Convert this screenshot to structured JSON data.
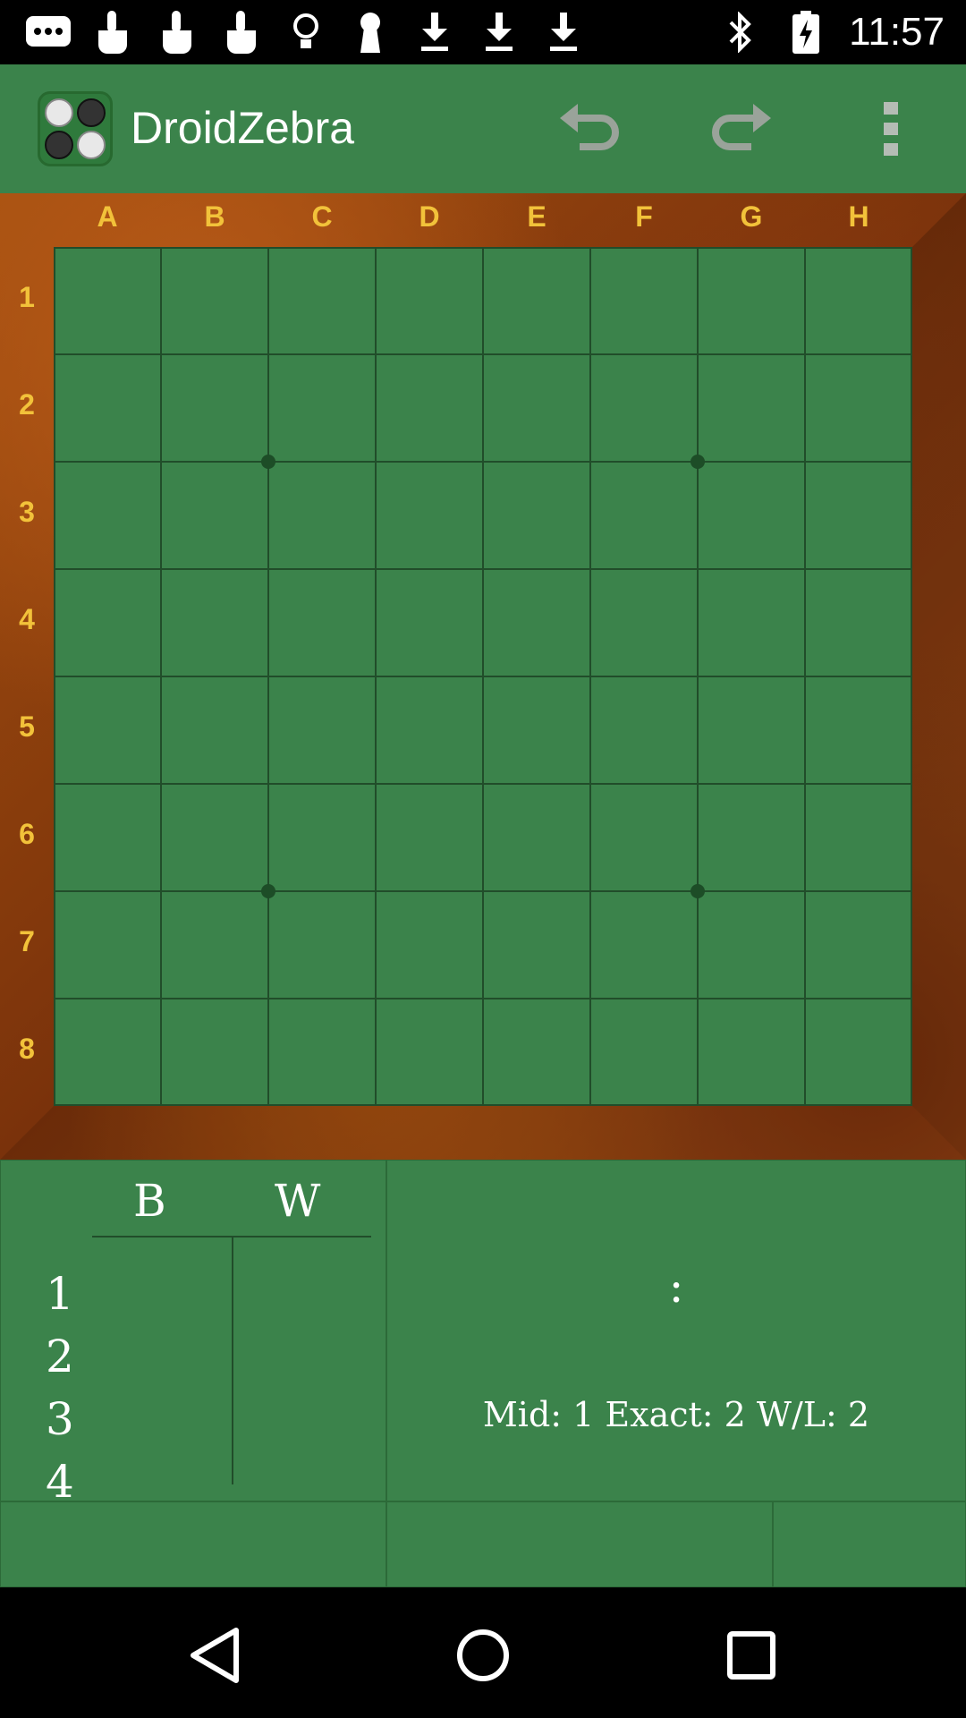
{
  "status_bar": {
    "time": "11:57",
    "left_icons": [
      "chat-icon",
      "touch-icon",
      "touch-icon",
      "touch-icon",
      "lightbulb-icon",
      "keyhole-icon",
      "download-icon",
      "download-icon",
      "download-icon"
    ],
    "right_icons": [
      "bluetooth-icon",
      "battery-charging-icon"
    ]
  },
  "app_bar": {
    "title": "DroidZebra",
    "actions": [
      "undo-icon",
      "redo-icon",
      "more-vert-icon"
    ]
  },
  "board": {
    "columns": [
      "A",
      "B",
      "C",
      "D",
      "E",
      "F",
      "G",
      "H"
    ],
    "rows": [
      "1",
      "2",
      "3",
      "4",
      "5",
      "6",
      "7",
      "8"
    ],
    "colors": {
      "felt": "#3b834b",
      "grid": "#214d2a",
      "label": "#f2c23a"
    }
  },
  "moves": {
    "header_black": "B",
    "header_white": "W",
    "move_numbers": [
      "1",
      "2",
      "3",
      "4"
    ]
  },
  "info": {
    "colon": ":",
    "stats": "Mid: 1 Exact: 2 W/L: 2"
  },
  "nav_bar": {
    "buttons": [
      "back-icon",
      "home-icon",
      "recents-icon"
    ]
  }
}
